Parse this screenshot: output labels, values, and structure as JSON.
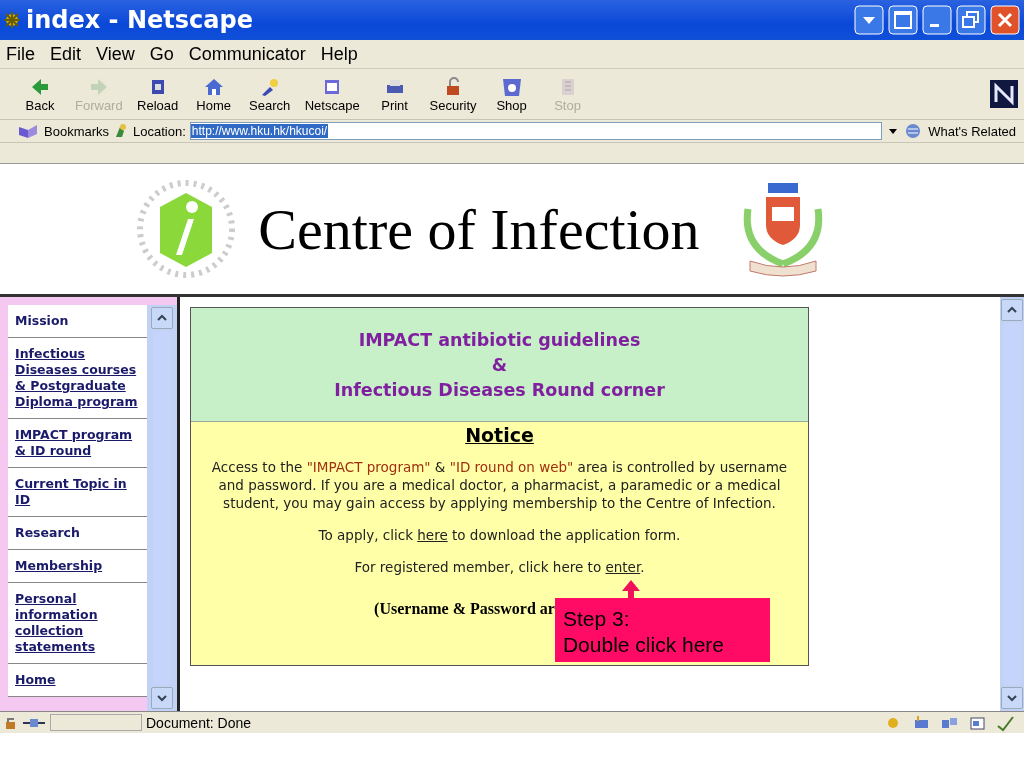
{
  "window": {
    "title": "index - Netscape"
  },
  "menu": [
    "File",
    "Edit",
    "View",
    "Go",
    "Communicator",
    "Help"
  ],
  "toolbar": [
    {
      "label": "Back",
      "disabled": false
    },
    {
      "label": "Forward",
      "disabled": true
    },
    {
      "label": "Reload",
      "disabled": false
    },
    {
      "label": "Home",
      "disabled": false
    },
    {
      "label": "Search",
      "disabled": false
    },
    {
      "label": "Netscape",
      "disabled": false
    },
    {
      "label": "Print",
      "disabled": false
    },
    {
      "label": "Security",
      "disabled": false
    },
    {
      "label": "Shop",
      "disabled": false
    },
    {
      "label": "Stop",
      "disabled": true
    }
  ],
  "location_bar": {
    "bookmarks": "Bookmarks",
    "label": "Location:",
    "url": "http://www.hku.hk/hkucoi/",
    "url_selected": true,
    "related": "What's Related"
  },
  "header": {
    "title": "Centre of Infection"
  },
  "sidebar": {
    "items": [
      {
        "label": "Mission",
        "kind": "plain"
      },
      {
        "label": "Infectious Diseases courses & Postgraduate Diploma program",
        "kind": "link"
      },
      {
        "label": "IMPACT program & ID round",
        "kind": "link"
      },
      {
        "label": "Current Topic in ID",
        "kind": "link"
      },
      {
        "label": "Research",
        "kind": "plain"
      },
      {
        "label": "Membership",
        "kind": "link"
      },
      {
        "label": "Personal information collection statements",
        "kind": "link"
      },
      {
        "label": "Home",
        "kind": "link"
      }
    ]
  },
  "content": {
    "heading": [
      "IMPACT antibiotic guidelines",
      "&",
      "Infectious Diseases Round corner"
    ],
    "notice_title": "Notice",
    "paragraph": [
      {
        "text": "Access to the ",
        "highlight": false
      },
      {
        "text": "\"IMPACT program\"",
        "highlight": true
      },
      {
        "text": " & ",
        "highlight": false
      },
      {
        "text": "\"ID round on web\"",
        "highlight": true
      },
      {
        "text": " area is controlled by username and password. If you are a medical doctor, a pharmacist, a paramedic or a medical student, you may gain access by applying membership to the Centre of Infection.",
        "highlight": false
      }
    ],
    "apply": {
      "before": "To apply, click ",
      "link": "here",
      "after": " to download the application form."
    },
    "enter": {
      "before": "For registered member, click here to ",
      "link": "enter",
      "after": "."
    },
    "note": "(Username & Password ar"
  },
  "callout": {
    "lines": [
      "Step 3:",
      "Double click here"
    ]
  },
  "status_bar": {
    "text": "Document: Done"
  }
}
